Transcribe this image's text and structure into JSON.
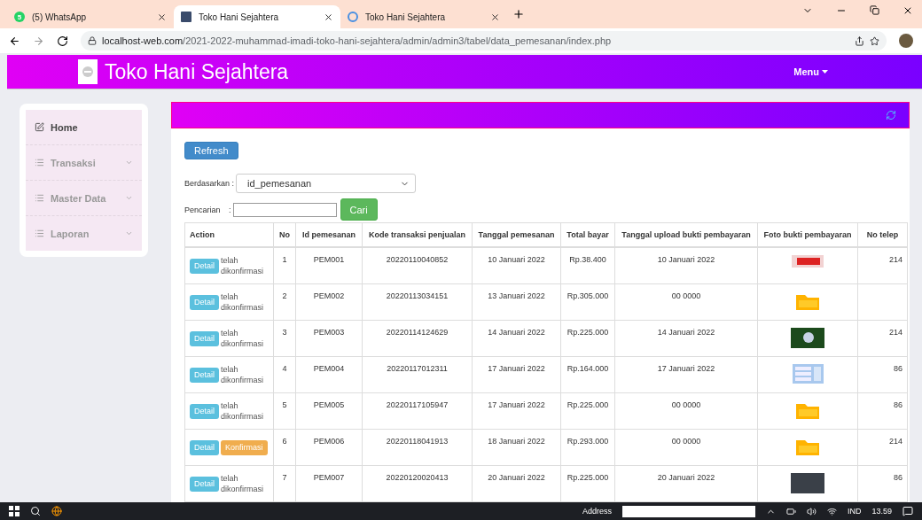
{
  "browser": {
    "tabs": [
      {
        "title": "(5) WhatsApp",
        "badge": "5",
        "kind": "chat",
        "selected": false
      },
      {
        "title": "Toko Hani Sejahtera",
        "kind": "site",
        "selected": true
      },
      {
        "title": "Toko Hani Sejahtera",
        "kind": "loading",
        "selected": false
      }
    ],
    "url_host": "localhost-web.com",
    "url_path": "/2021-2022-muhammad-imadi-toko-hani-sejahtera/admin/admin3/tabel/data_pemesanan/index.php"
  },
  "navbar": {
    "brand": "Toko Hani Sejahtera",
    "menu": "Menu"
  },
  "sidebar": {
    "items": [
      {
        "label": "Home",
        "kind": "home",
        "selected": true
      },
      {
        "label": "Transaksi",
        "kind": "dropdown",
        "selected": false
      },
      {
        "label": "Master Data",
        "kind": "dropdown",
        "selected": false
      },
      {
        "label": "Laporan",
        "kind": "dropdown",
        "selected": false
      }
    ]
  },
  "panel": {
    "refresh_button": "Refresh",
    "filter_label": "Berdasarkan :",
    "filter_value": "id_pemesanan",
    "search_label": "Pencarian",
    "search_colon": ":",
    "search_button": "Cari"
  },
  "table": {
    "columns": [
      "Action",
      "No",
      "Id pemesanan",
      "Kode transaksi penjualan",
      "Tanggal pemesanan",
      "Total bayar",
      "Tanggal upload bukti pembayaran",
      "Foto bukti pembayaran",
      "No telep"
    ],
    "rows": [
      {
        "kind": "confirmed",
        "detail": "Detail",
        "status": "telah dikonfirmasi",
        "no": "1",
        "id": "PEM001",
        "kode": "20220110040852",
        "tanggal": "10 Januari 2022",
        "total": "Rp.38.400",
        "upload": "10 Januari 2022",
        "photo": {
          "kind": "banner"
        },
        "phone": "214"
      },
      {
        "kind": "confirmed",
        "detail": "Detail",
        "status": "telah dikonfirmasi",
        "no": "2",
        "id": "PEM002",
        "kode": "20220113034151",
        "tanggal": "13 Januari 2022",
        "total": "Rp.305.000",
        "upload": "00 0000",
        "photo": {
          "kind": "file"
        }
      },
      {
        "kind": "confirmed",
        "detail": "Detail",
        "status": "telah dikonfirmasi",
        "no": "3",
        "id": "PEM003",
        "kode": "20220114124629",
        "tanggal": "14 Januari 2022",
        "total": "Rp.225.000",
        "upload": "14 Januari 2022",
        "photo": {
          "kind": "photo"
        },
        "phone": "214"
      },
      {
        "kind": "confirmed",
        "detail": "Detail",
        "status": "telah dikonfirmasi",
        "no": "4",
        "id": "PEM004",
        "kode": "20220117012311",
        "tanggal": "17 Januari 2022",
        "total": "Rp.164.000",
        "upload": "17 Januari 2022",
        "photo": {
          "kind": "form"
        },
        "phone": "86"
      },
      {
        "kind": "confirmed",
        "detail": "Detail",
        "status": "telah dikonfirmasi",
        "no": "5",
        "id": "PEM005",
        "kode": "20220117105947",
        "tanggal": "17 Januari 2022",
        "total": "Rp.225.000",
        "upload": "00 0000",
        "photo": {
          "kind": "file"
        },
        "phone": "86"
      },
      {
        "kind": "pending",
        "detail": "Detail",
        "status": "Konfirmasi",
        "no": "6",
        "id": "PEM006",
        "kode": "20220118041913",
        "tanggal": "18 Januari 2022",
        "total": "Rp.293.000",
        "upload": "00 0000",
        "photo": {
          "kind": "file"
        },
        "phone": "214"
      },
      {
        "kind": "confirmed",
        "detail": "Detail",
        "status": "telah dikonfirmasi",
        "no": "7",
        "id": "PEM007",
        "kode": "20220120020413",
        "tanggal": "20 Januari 2022",
        "total": "Rp.225.000",
        "upload": "20 Januari 2022",
        "photo": {
          "kind": "dark"
        },
        "phone": "86"
      }
    ]
  },
  "taskbar": {
    "address_label": "Address",
    "language": "IND",
    "time": "13.59"
  }
}
